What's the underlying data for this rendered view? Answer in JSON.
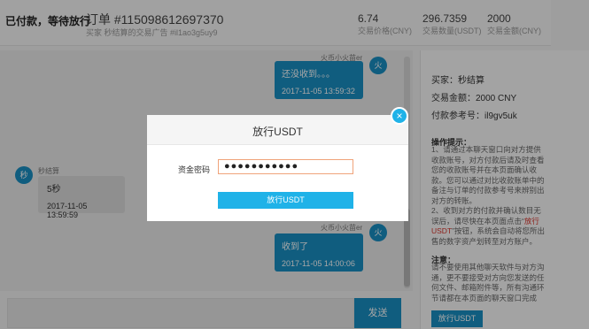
{
  "header": {
    "status": "已付款，等待放行",
    "order_no": "订单 #115098612697370",
    "order_sub": "买家 秒结算的交易广告 #il1ao3g5uy9",
    "stats": [
      {
        "value": "6.74",
        "label": "交易价格(CNY)"
      },
      {
        "value": "296.7359",
        "label": "交易数量(USDT)"
      },
      {
        "value": "2000",
        "label": "交易金额(CNY)"
      }
    ]
  },
  "chat": {
    "msg1": {
      "text": "还没收到。。。",
      "time": "2017-11-05 13:59:32",
      "avatar": "火"
    },
    "msg1_name": "火币小火苗er",
    "msg2": {
      "name": "秒结算",
      "avatar": "秒",
      "text": "5秒",
      "time": "2017-11-05 13:59:59"
    },
    "msg3": {
      "name": "火币小火苗er",
      "avatar": "火",
      "text": "收到了",
      "time": "2017-11-05 14:00:06"
    },
    "send_label": "发送"
  },
  "panel": {
    "buyer": "买家：秒结算",
    "amount": "交易金额：2000 CNY",
    "ref": "付款参考号：il9gv5uk",
    "tips_title": "操作提示：",
    "tip1": "1、请通过本聊天窗口向对方提供收款账号，对方付款后请及时查看您的收款账号并在本页面确认收款。您可以通过对比收款账单中的备注与订单的付款参考号来辨别出对方的转账。",
    "tip2_a": "2、收到对方的付款并确认数目无误后，请尽快在本页面点击“",
    "tip2_red": "放行USDT",
    "tip2_b": "”按钮，系统会自动将您所出售的数字资产划转至对方账户。",
    "note_title": "注意：",
    "note": "请不要使用其他聊天软件与对方沟通，更不要接受对方向您发送的任何文件、邮箱附件等，所有沟通环节请都在本页面的聊天窗口完成",
    "release_btn": "放行USDT"
  },
  "modal": {
    "title": "放行USDT",
    "close": "×",
    "pwd_label": "资金密码",
    "pwd_value": "●●●●●●●●●●●",
    "submit": "放行USDT"
  }
}
